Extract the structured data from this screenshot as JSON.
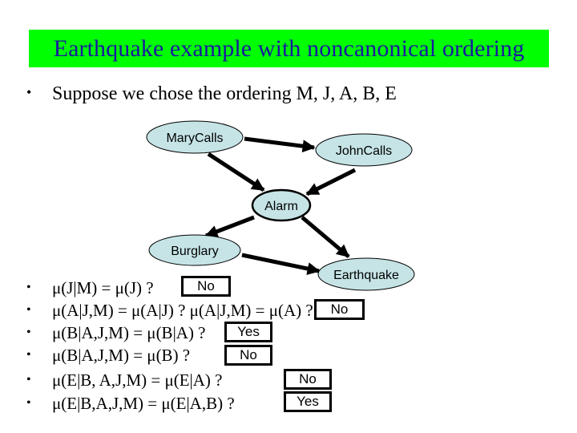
{
  "slide": {
    "title": "Earthquake example with noncanonical ordering",
    "title_bg_color": "#00ff00",
    "title_text_color": "#1a1aa0",
    "intro_bullet": "•",
    "intro_text": "Suppose we chose the ordering M, J, A, B, E"
  },
  "graph": {
    "node_fill": "#c6e4e6",
    "nodes": [
      {
        "id": "M",
        "label": "MaryCalls"
      },
      {
        "id": "J",
        "label": "JohnCalls"
      },
      {
        "id": "A",
        "label": "Alarm"
      },
      {
        "id": "B",
        "label": "Burglary"
      },
      {
        "id": "E",
        "label": "Earthquake"
      }
    ],
    "edges": [
      {
        "from": "M",
        "to": "J"
      },
      {
        "from": "M",
        "to": "A"
      },
      {
        "from": "J",
        "to": "A"
      },
      {
        "from": "A",
        "to": "B"
      },
      {
        "from": "A",
        "to": "E"
      },
      {
        "from": "B",
        "to": "E"
      }
    ]
  },
  "questions": [
    {
      "bullet": "•",
      "text": "μ(J|M) = μ(J) ?",
      "answer": "No"
    },
    {
      "bullet": "•",
      "text": "μ(A|J,M) = μ(A|J) ?  μ(A|J,M) = μ(A) ?",
      "answer": "No"
    },
    {
      "bullet": "•",
      "text": "μ(B|A,J,M) = μ(B|A) ?",
      "answer": "Yes"
    },
    {
      "bullet": "•",
      "text": "μ(B|A,J,M) = μ(B) ?",
      "answer": "No"
    },
    {
      "bullet": "•",
      "text": "μ(E|B, A,J,M) = μ(E|A) ?",
      "answer": "No"
    },
    {
      "bullet": "•",
      "text": "μ(E|B,A,J,M) = μ(E|A,B) ?",
      "answer": "Yes"
    }
  ]
}
